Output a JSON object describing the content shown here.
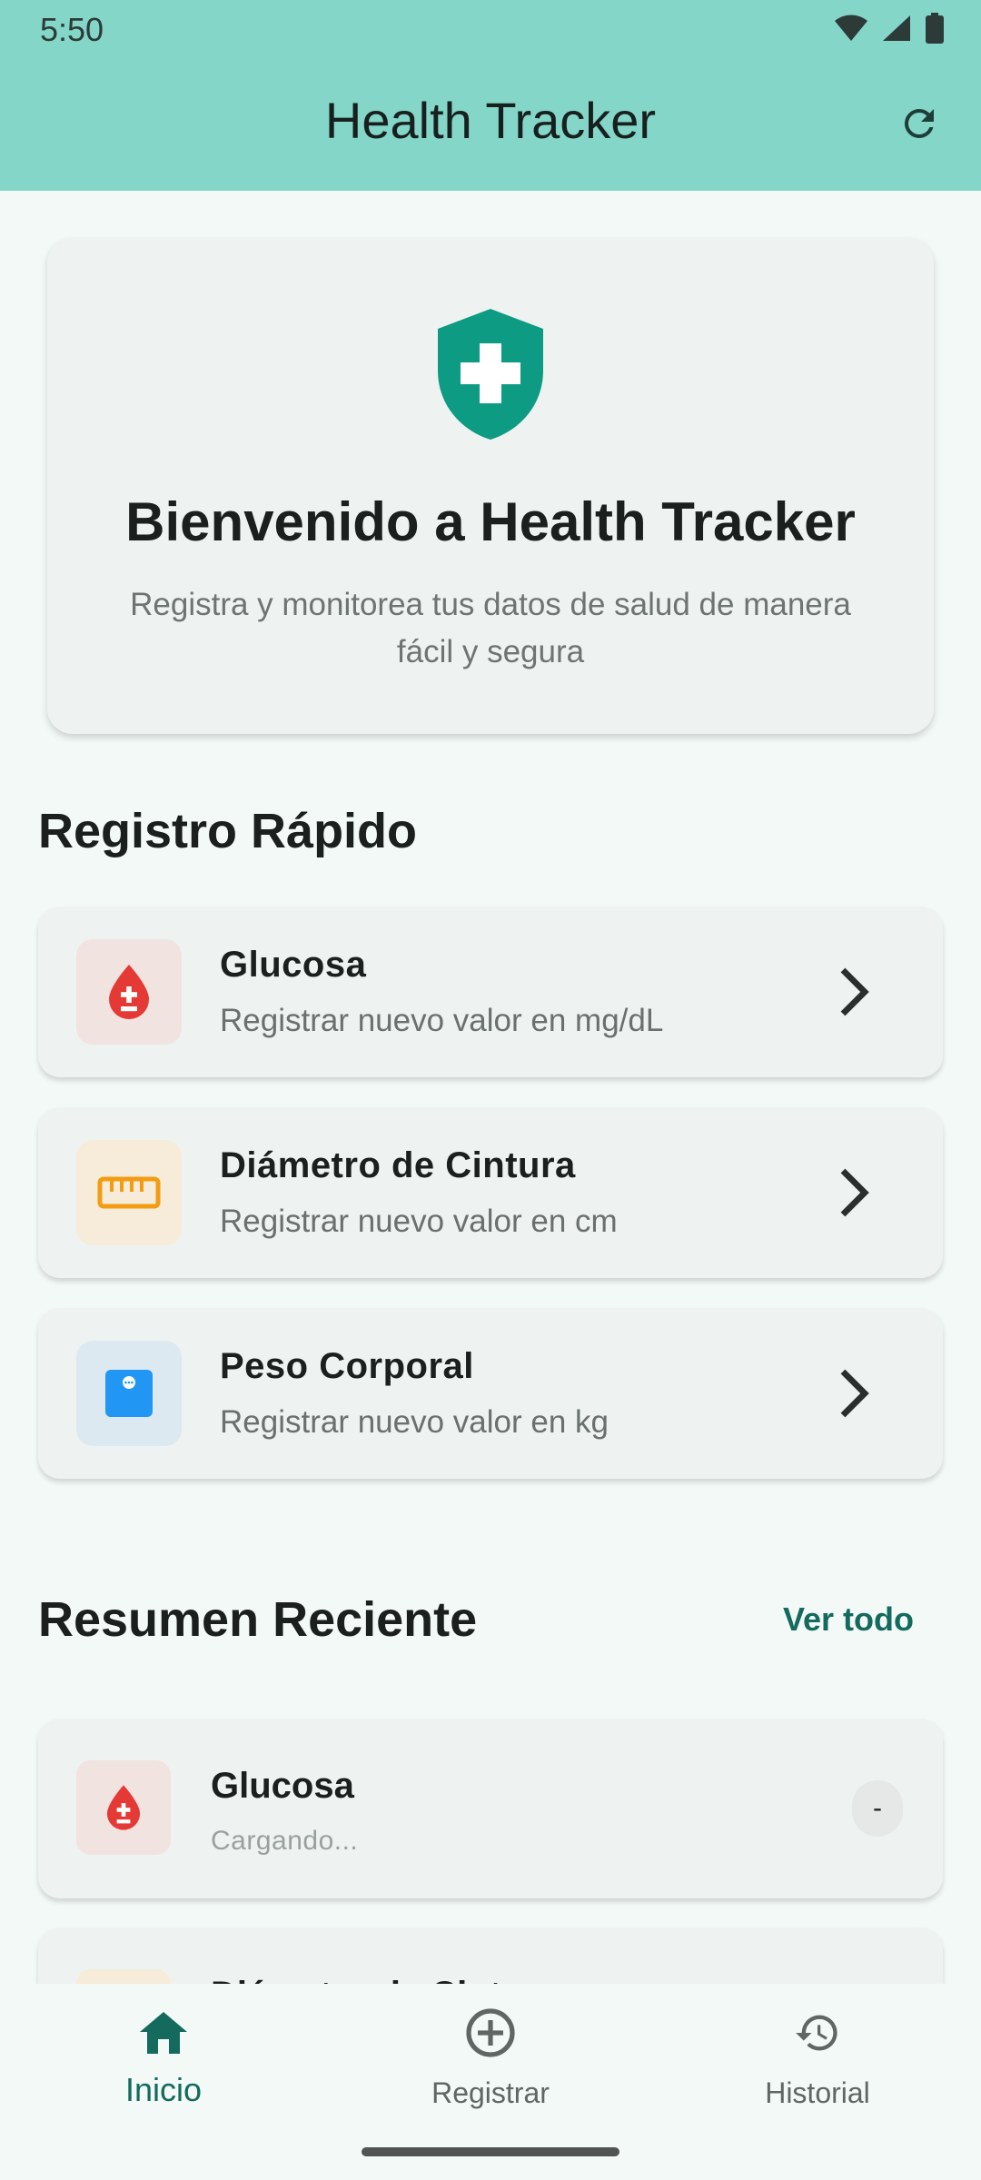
{
  "status_bar": {
    "time": "5:50"
  },
  "app_bar": {
    "title": "Health Tracker",
    "refresh_icon": "refresh-icon"
  },
  "welcome": {
    "title": "Bienvenido a Health Tracker",
    "subtitle": "Registra y monitorea tus datos de salud de manera fácil y segura",
    "icon": "shield-plus-icon"
  },
  "quick_register": {
    "title": "Registro Rápido",
    "items": [
      {
        "title": "Glucosa",
        "subtitle": "Registrar nuevo valor en mg/dL",
        "icon": "blood-drop-icon",
        "icon_bg": "#f1e3e0",
        "icon_color": "#e53935"
      },
      {
        "title": "Diámetro de Cintura",
        "subtitle": "Registrar nuevo valor en cm",
        "icon": "ruler-icon",
        "icon_bg": "#f6ecd9",
        "icon_color": "#f39c12"
      },
      {
        "title": "Peso Corporal",
        "subtitle": "Registrar nuevo valor en kg",
        "icon": "scale-icon",
        "icon_bg": "#dde9f0",
        "icon_color": "#2196f3"
      }
    ]
  },
  "recent_summary": {
    "title": "Resumen Reciente",
    "see_all": "Ver todo",
    "items": [
      {
        "title": "Glucosa",
        "status": "Cargando...",
        "badge": "-",
        "icon": "blood-drop-icon"
      },
      {
        "title": "Diámetro de Cintura"
      }
    ]
  },
  "bottom_nav": {
    "items": [
      {
        "label": "Inicio",
        "icon": "home-icon",
        "active": true
      },
      {
        "label": "Registrar",
        "icon": "add-circle-icon",
        "active": false
      },
      {
        "label": "Historial",
        "icon": "history-icon",
        "active": false
      }
    ]
  },
  "colors": {
    "primary": "#84d6c8",
    "accent": "#136a5d",
    "shield": "#0d9b84"
  }
}
